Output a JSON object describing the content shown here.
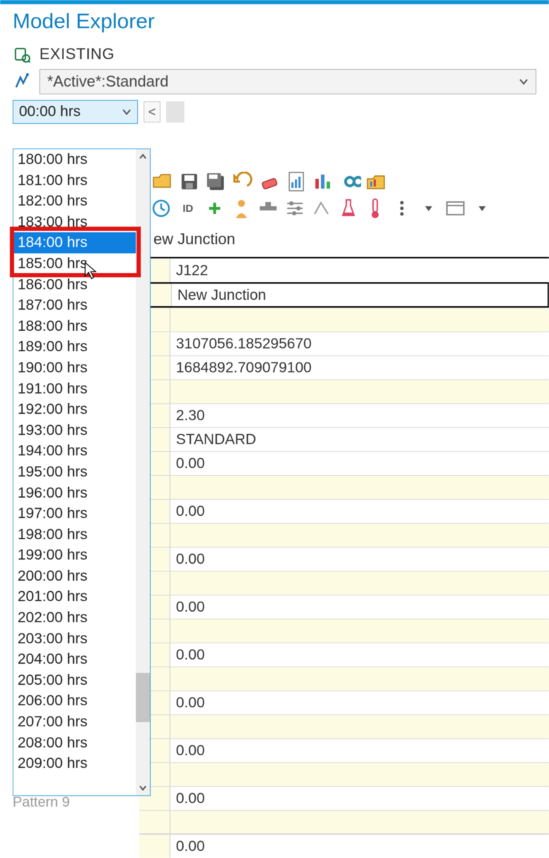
{
  "window": {
    "title": "Model Explorer"
  },
  "scenario": {
    "label": "EXISTING"
  },
  "alternative": {
    "label": "*Active*:Standard"
  },
  "time": {
    "selected": "00:00 hrs",
    "highlighted": "184:00 hrs",
    "options": [
      "180:00 hrs",
      "181:00 hrs",
      "182:00 hrs",
      "183:00 hrs",
      "184:00 hrs",
      "185:00 hrs",
      "186:00 hrs",
      "187:00 hrs",
      "188:00 hrs",
      "189:00 hrs",
      "190:00 hrs",
      "191:00 hrs",
      "192:00 hrs",
      "193:00 hrs",
      "194:00 hrs",
      "195:00 hrs",
      "196:00 hrs",
      "197:00 hrs",
      "198:00 hrs",
      "199:00 hrs",
      "200:00 hrs",
      "201:00 hrs",
      "202:00 hrs",
      "203:00 hrs",
      "204:00 hrs",
      "205:00 hrs",
      "206:00 hrs",
      "207:00 hrs",
      "208:00 hrs",
      "209:00 hrs"
    ]
  },
  "tab": {
    "label": "ew Junction"
  },
  "properties": {
    "id": "J122",
    "desc": "New Junction",
    "x": "3107056.185295670",
    "y": "1684892.709079100",
    "v1": "2.30",
    "v2": "STANDARD",
    "v3": "0.00",
    "p": [
      "0.00",
      "0.00",
      "0.00",
      "0.00",
      "0.00",
      "0.00",
      "0.00",
      "0.00"
    ]
  },
  "footer": {
    "text": "Pattern 9"
  }
}
